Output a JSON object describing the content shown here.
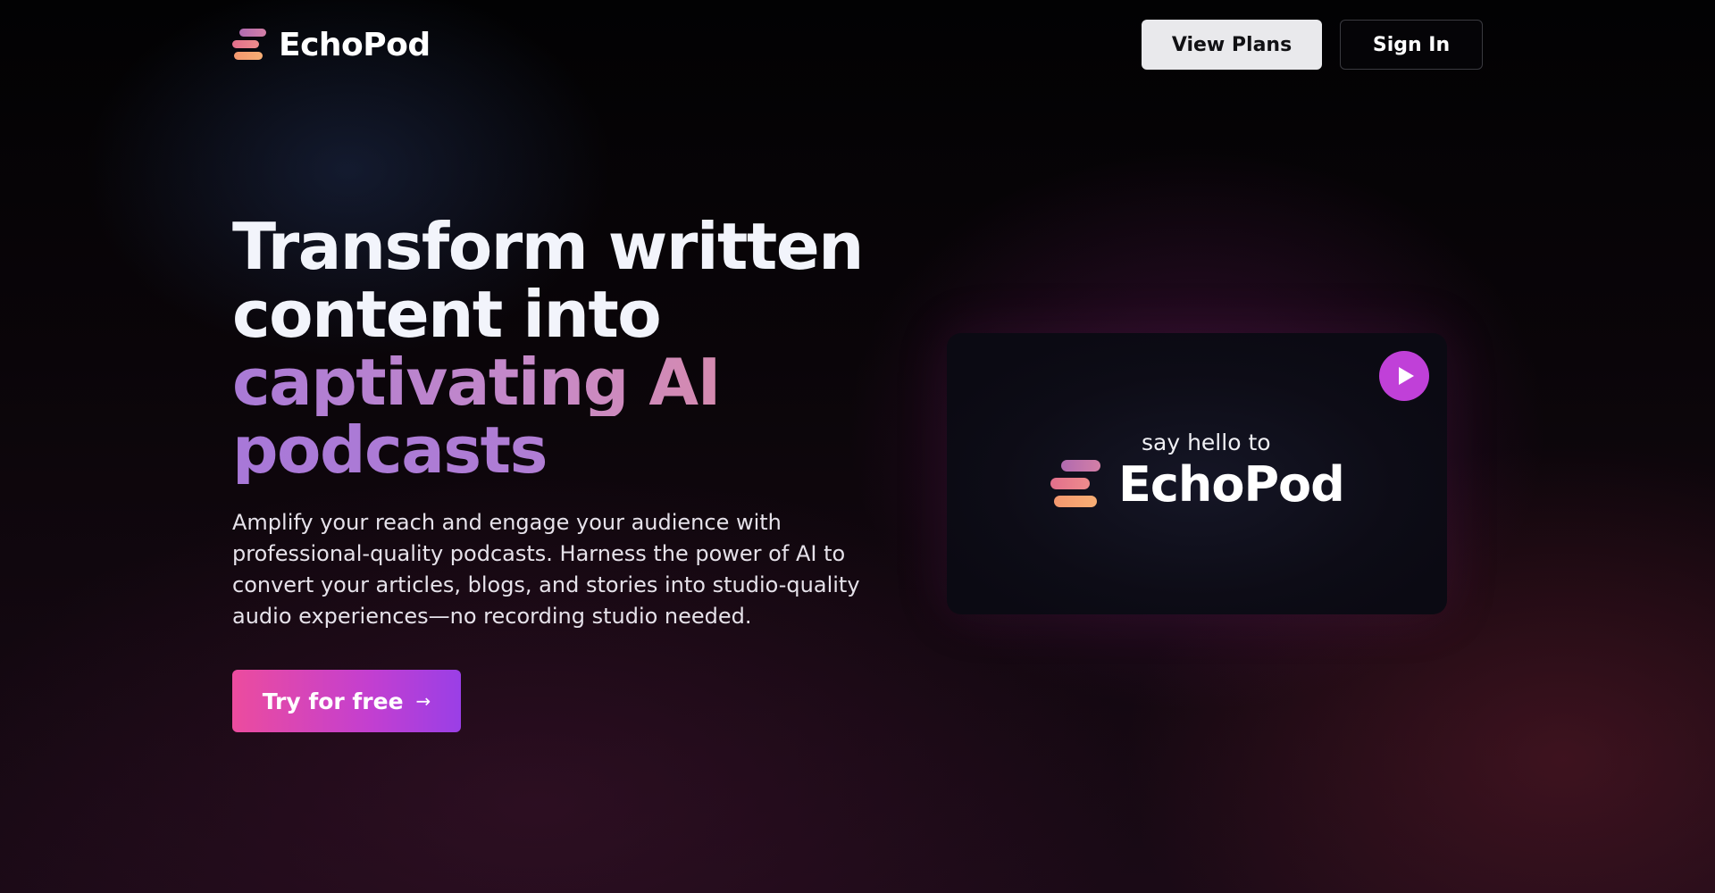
{
  "header": {
    "brand": "EchoPod",
    "nav": {
      "view_plans": "View Plans",
      "sign_in": "Sign In"
    }
  },
  "hero": {
    "title_line1": "Transform written",
    "title_line2": "content into",
    "title_line3": "captivating AI",
    "title_line4": "podcasts",
    "description": "Amplify your reach and engage your audience with professional-quality podcasts. Harness the power of AI to convert your articles, blogs, and stories into studio-quality audio experiences—no recording studio needed.",
    "cta_label": "Try for free",
    "cta_icon": "arrow-right-icon"
  },
  "video": {
    "tagline": "say hello to",
    "brand": "EchoPod",
    "play_icon": "play-icon"
  },
  "colors": {
    "accent_gradient_start": "#ec4c9e",
    "accent_gradient_end": "#9a3fe6",
    "play_button": "#c040d8",
    "title_gradient_start": "#a97ad6",
    "title_gradient_end": "#d98aa8"
  }
}
